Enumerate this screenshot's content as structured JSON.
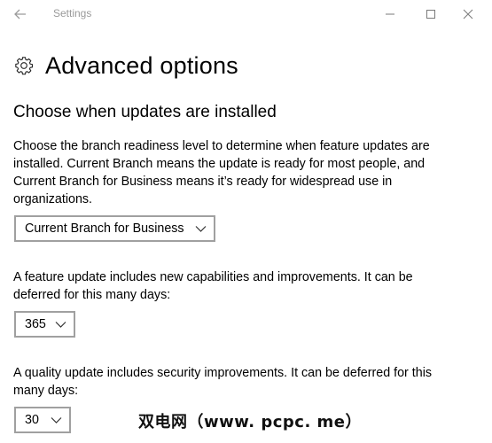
{
  "window": {
    "title": "Settings",
    "back_icon": "back-arrow-icon",
    "controls": [
      "minimize-icon",
      "maximize-icon",
      "close-icon"
    ]
  },
  "header": {
    "icon": "gear-icon",
    "title": "Advanced options"
  },
  "section": {
    "title": "Choose when updates are installed"
  },
  "branch": {
    "description_lines": [
      "Choose the branch readiness level to determine when feature updates are",
      "installed. Current Branch means the update is ready for most people, and",
      "Current Branch for Business means it’s ready for widespread use in",
      "organizations."
    ],
    "selected": "Current Branch for Business"
  },
  "feature_update": {
    "description_lines": [
      "A feature update includes new capabilities and improvements. It can be",
      "deferred for this many days:"
    ],
    "selected": "365"
  },
  "quality_update": {
    "description_lines": [
      "A quality update includes security improvements. It can be deferred for this",
      "many days:"
    ],
    "selected": "30"
  },
  "watermark": "双电网（www. pcpc. me）"
}
